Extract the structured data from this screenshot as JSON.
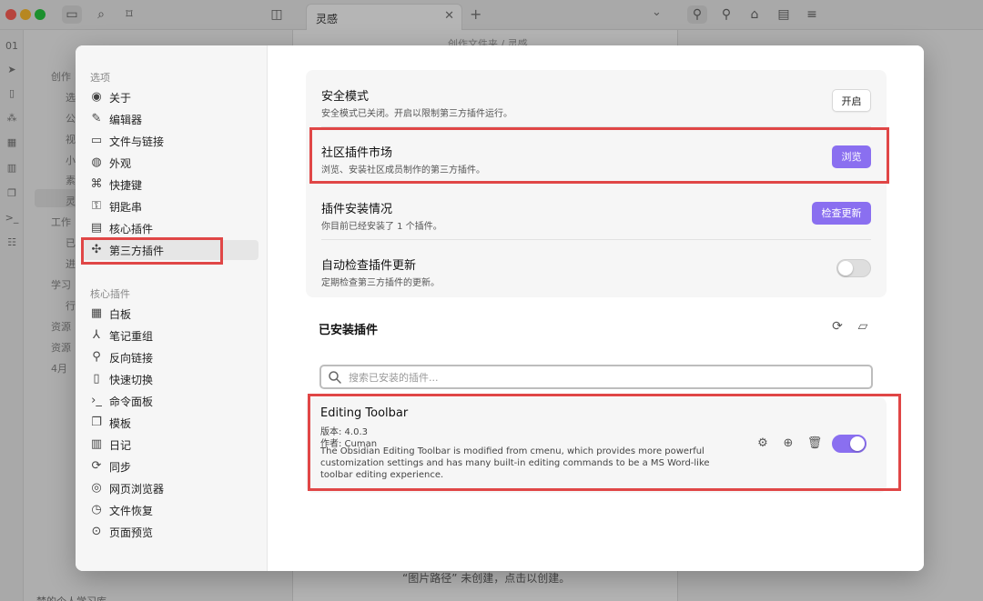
{
  "app": {
    "tab_title": "灵感",
    "breadcrumb": "创作文件夹 / 灵感",
    "sidebar_items": [
      "创作",
      "选",
      "公",
      "视",
      "小",
      "素",
      "灵",
      "工作",
      "已",
      "进",
      "学习",
      "行",
      "资源",
      "资源",
      "4月"
    ],
    "editor_hint": "“图片路径” 未创建，点击以创建。",
    "bottom_vault": "梦的个人学习库"
  },
  "settings": {
    "nav": {
      "options_heading": "选项",
      "options": [
        {
          "label": "关于",
          "icon": "user-circle-icon"
        },
        {
          "label": "编辑器",
          "icon": "pencil-icon"
        },
        {
          "label": "文件与链接",
          "icon": "folder-link-icon"
        },
        {
          "label": "外观",
          "icon": "palette-icon"
        },
        {
          "label": "快捷键",
          "icon": "command-icon"
        },
        {
          "label": "钥匙串",
          "icon": "key-icon"
        },
        {
          "label": "核心插件",
          "icon": "calendar-plug-icon"
        },
        {
          "label": "第三方插件",
          "icon": "puzzle-icon"
        }
      ],
      "core_heading": "核心插件",
      "core": [
        {
          "label": "白板",
          "icon": "grid-icon"
        },
        {
          "label": "笔记重组",
          "icon": "merge-icon"
        },
        {
          "label": "反向链接",
          "icon": "backlink-icon"
        },
        {
          "label": "快速切换",
          "icon": "file-switch-icon"
        },
        {
          "label": "命令面板",
          "icon": "terminal-icon"
        },
        {
          "label": "模板",
          "icon": "copy-icon"
        },
        {
          "label": "日记",
          "icon": "calendar-icon"
        },
        {
          "label": "同步",
          "icon": "sync-icon"
        },
        {
          "label": "网页浏览器",
          "icon": "globe-icon"
        },
        {
          "label": "文件恢复",
          "icon": "history-icon"
        },
        {
          "label": "页面预览",
          "icon": "preview-icon"
        }
      ]
    },
    "rows": {
      "safe_mode": {
        "title": "安全模式",
        "desc": "安全模式已关闭。开启以限制第三方插件运行。",
        "button": "开启"
      },
      "community": {
        "title": "社区插件市场",
        "desc": "浏览、安装社区成员制作的第三方插件。",
        "button": "浏览"
      },
      "installed_status": {
        "title": "插件安装情况",
        "desc": "你目前已经安装了 1 个插件。",
        "button": "检查更新"
      },
      "auto_update": {
        "title": "自动检查插件更新",
        "desc": "定期检查第三方插件的更新。",
        "toggle_on": false
      }
    },
    "installed": {
      "heading": "已安装插件",
      "search_placeholder": "搜索已安装的插件...",
      "plugin": {
        "name": "Editing Toolbar",
        "version": "版本: 4.0.3",
        "author": "作者: Cuman",
        "description": "The Obsidian Editing Toolbar is modified from cmenu, which provides more powerful customization settings and has many built-in editing commands to be a MS Word-like toolbar editing experience.",
        "enabled": true
      }
    },
    "colors": {
      "accent": "#8a6ff0",
      "highlight": "#e04646"
    }
  }
}
